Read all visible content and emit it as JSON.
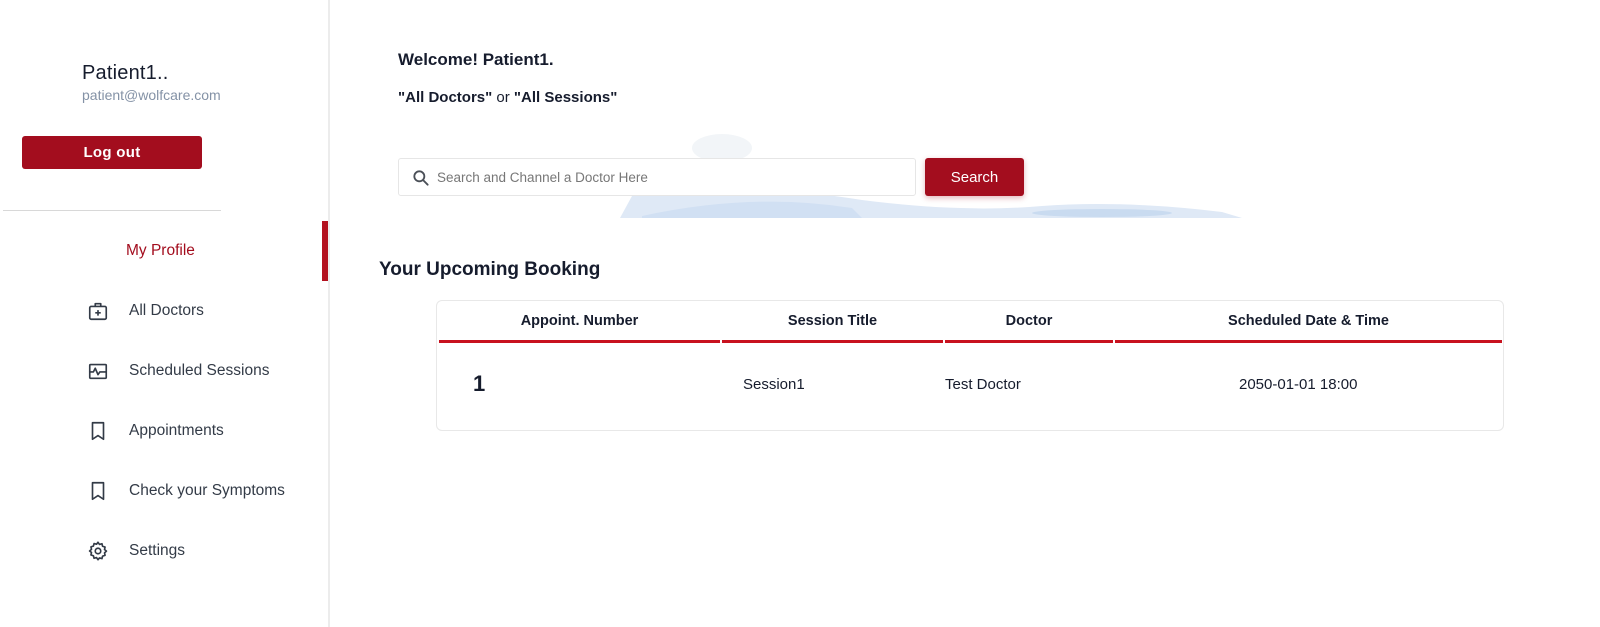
{
  "profile": {
    "name": "Patient1..",
    "email": "patient@wolfcare.com",
    "logout_label": "Log out"
  },
  "sidebar": {
    "items": [
      {
        "label": "My Profile",
        "icon": "none",
        "active": true
      },
      {
        "label": "All Doctors",
        "icon": "medical-kit-icon"
      },
      {
        "label": "Scheduled Sessions",
        "icon": "schedule-icon"
      },
      {
        "label": "Appointments",
        "icon": "bookmark-icon"
      },
      {
        "label": "Check your Symptoms",
        "icon": "bookmark-icon"
      },
      {
        "label": "Settings",
        "icon": "gear-icon"
      }
    ]
  },
  "main": {
    "welcome": "Welcome! Patient1.",
    "subline_part1": "\"All Doctors\"",
    "subline_or": " or ",
    "subline_part2": "\"All Sessions\"",
    "search_placeholder": "Search and Channel a Doctor Here",
    "search_button": "Search",
    "section_title": "Your Upcoming Booking"
  },
  "booking_table": {
    "headers": [
      "Appoint. Number",
      "Session Title",
      "Doctor",
      "Scheduled Date & Time"
    ],
    "rows": [
      {
        "number": "1",
        "session_title": "Session1",
        "doctor": "Test Doctor",
        "datetime": "2050-01-01 18:00"
      }
    ]
  },
  "colors": {
    "accent": "#a30d1e",
    "text": "#161c2d",
    "muted": "#8492a6"
  }
}
